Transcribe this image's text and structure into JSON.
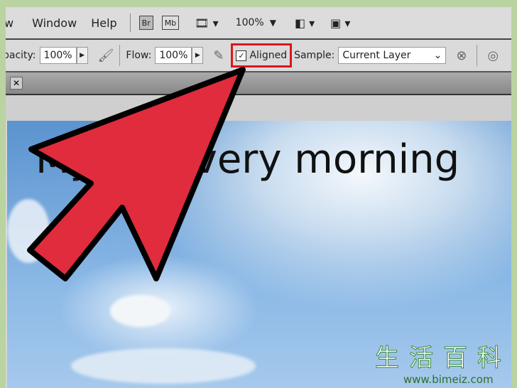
{
  "menu": {
    "items": [
      "w",
      "Window",
      "Help"
    ],
    "bridge": "Br",
    "minibridge": "Mb",
    "zoom": "100%"
  },
  "options": {
    "opacity_label": "pacity:",
    "opacity": "100%",
    "flow_label": "Flow:",
    "flow": "100%",
    "aligned_label": "Aligned",
    "aligned_checked": true,
    "sample_label": "Sample:",
    "sample_value": "Current Layer"
  },
  "canvas": {
    "text": "My      every morning"
  },
  "highlight_color": "#e0141e",
  "arrow_color": "#e02c3c",
  "watermark": {
    "chars": "生活百科",
    "url": "www.bimeiz.com"
  }
}
